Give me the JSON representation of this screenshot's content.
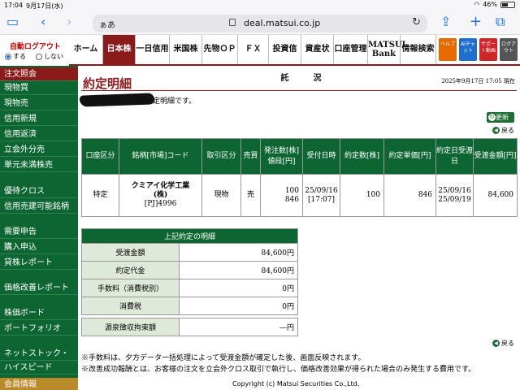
{
  "status_bar": {
    "time": "17:04",
    "date": "9月17日(水)",
    "battery": "46%"
  },
  "browser": {
    "aa": "ぁあ",
    "url": "deal.matsui.co.jp"
  },
  "logout": {
    "title": "自動ログアウト",
    "opt_on": "する",
    "opt_off": "しない"
  },
  "top_menu": {
    "home": "ホーム",
    "items": [
      "日本株",
      "一日信用",
      "米国株",
      "先物ＯＰ",
      "ＦＸ",
      "投資信託",
      "資産状況",
      "口座管理"
    ],
    "matsui_bank_1": "MATSUI",
    "matsui_bank_2": "Bank",
    "info_search": "情報検索",
    "help": "ヘルプ",
    "ai_chat": "AIチャット",
    "support": "サポート動画",
    "logout_short": "ログアウト"
  },
  "left_nav": [
    "注文照会",
    "現物買",
    "現物売",
    "信用新規",
    "信用返済",
    "立会外分売",
    "単元未満株売",
    "優待クロス",
    "信用売建可能銘柄",
    "需要申告",
    "購入申込",
    "貸株レポート",
    "価格改善レポート",
    "株価ボード",
    "ポートフォリオ",
    "ネットストック・",
    "ハイスピード",
    "会員情報"
  ],
  "main": {
    "title": "約定明細",
    "datetime": "2025年9月17日 17:05 現在",
    "message": "定明細です。",
    "update_button": "更新",
    "back": "戻る"
  },
  "orders_table": {
    "headers": [
      "口座区分",
      "銘柄[市場]コード",
      "取引区分",
      "売買",
      "発注数[株]値段[円]",
      "受付日時",
      "約定数[株]",
      "約定単価[円]",
      "約定日受渡日",
      "受渡金額[円]"
    ],
    "row": {
      "account": "特定",
      "name_1": "クミアイ化学工業",
      "name_2": "(株)",
      "code": "[PJ]4996",
      "trade_type": "現物",
      "side": "売",
      "order_qty": "100",
      "order_price": "846",
      "received_date": "25/09/16",
      "received_time": "[17:07]",
      "exec_qty": "100",
      "exec_price": "846",
      "exec_date": "25/09/16",
      "settle_date": "25/09/19",
      "amount": "84,600"
    }
  },
  "detail_table": {
    "title": "上記約定の明細",
    "rows": [
      {
        "label": "受渡金額",
        "value": "84,600円"
      },
      {
        "label": "約定代金",
        "value": "84,600円"
      },
      {
        "label": "手数料（消費税別）",
        "value": "0円"
      },
      {
        "label": "消費税",
        "value": "0円"
      },
      {
        "label": "源泉徴収拘束額",
        "value": "―円"
      }
    ]
  },
  "notes": [
    "※手数料は、夕方データ一括処理によって受渡金額が確定した後、画面反映されます。",
    "※改善成功報酬とは、お客様の注文を立会外クロス取引で執行し、価格改善効果が得られた場合のみ発生する費用です。"
  ],
  "copyright": "Copyright (c) Matsui Securities Co.,Ltd.",
  "colors": {
    "brand_green": "#0d6631",
    "brand_red": "#8b1a1a"
  }
}
